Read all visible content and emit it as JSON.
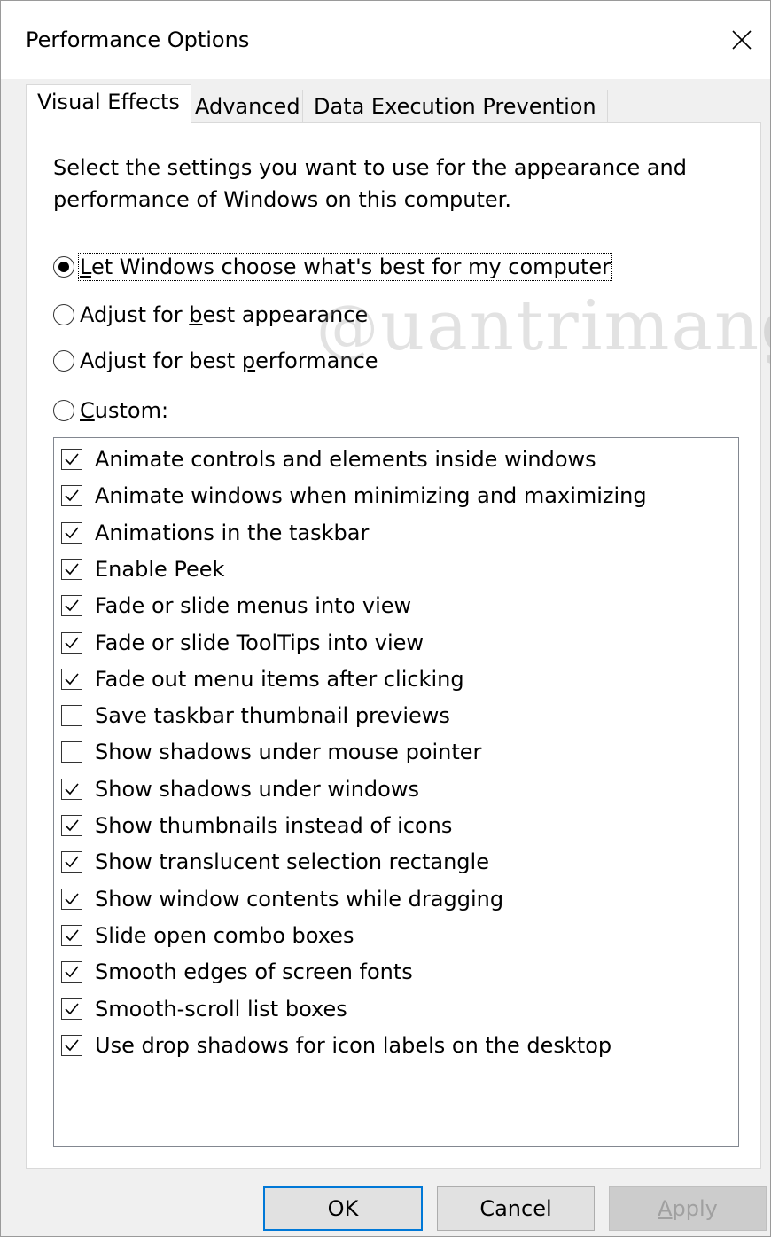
{
  "window": {
    "title": "Performance Options"
  },
  "tabs": [
    {
      "label": "Visual Effects",
      "active": true
    },
    {
      "label": "Advanced",
      "active": false
    },
    {
      "label": "Data Execution Prevention",
      "active": false
    }
  ],
  "description": "Select the settings you want to use for the appearance and performance of Windows on this computer.",
  "radios": [
    {
      "pre": "",
      "key": "L",
      "post": "et Windows choose what's best for my computer",
      "checked": true
    },
    {
      "pre": "Adjust for ",
      "key": "b",
      "post": "est appearance",
      "checked": false
    },
    {
      "pre": "Adjust for best ",
      "key": "p",
      "post": "erformance",
      "checked": false
    },
    {
      "pre": "",
      "key": "C",
      "post": "ustom:",
      "checked": false
    }
  ],
  "options": [
    {
      "label": "Animate controls and elements inside windows",
      "checked": true
    },
    {
      "label": "Animate windows when minimizing and maximizing",
      "checked": true
    },
    {
      "label": "Animations in the taskbar",
      "checked": true
    },
    {
      "label": "Enable Peek",
      "checked": true
    },
    {
      "label": "Fade or slide menus into view",
      "checked": true
    },
    {
      "label": "Fade or slide ToolTips into view",
      "checked": true
    },
    {
      "label": "Fade out menu items after clicking",
      "checked": true
    },
    {
      "label": "Save taskbar thumbnail previews",
      "checked": false
    },
    {
      "label": "Show shadows under mouse pointer",
      "checked": false
    },
    {
      "label": "Show shadows under windows",
      "checked": true
    },
    {
      "label": "Show thumbnails instead of icons",
      "checked": true
    },
    {
      "label": "Show translucent selection rectangle",
      "checked": true
    },
    {
      "label": "Show window contents while dragging",
      "checked": true
    },
    {
      "label": "Slide open combo boxes",
      "checked": true
    },
    {
      "label": "Smooth edges of screen fonts",
      "checked": true
    },
    {
      "label": "Smooth-scroll list boxes",
      "checked": true
    },
    {
      "label": "Use drop shadows for icon labels on the desktop",
      "checked": true
    }
  ],
  "buttons": {
    "ok": "OK",
    "cancel": "Cancel",
    "apply_key": "A",
    "apply_rest": "pply"
  },
  "watermark": {
    "at": "@",
    "text": "uantrimang"
  },
  "colors": {
    "focus_border": "#0078d7",
    "window_bg": "#f0f0f0"
  }
}
